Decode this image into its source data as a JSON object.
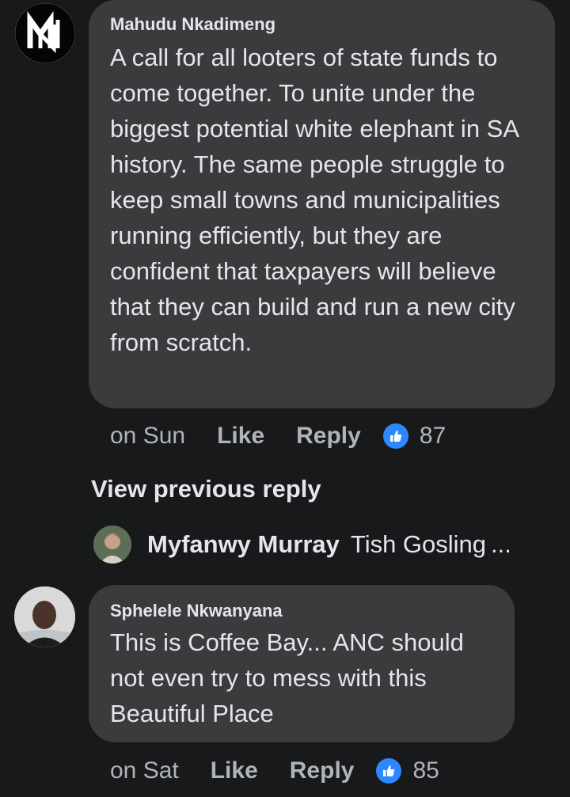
{
  "comments": [
    {
      "author": "Mahudu Nkadimeng",
      "text": "A call for all looters of state funds to come together. To unite under the biggest potential white elephant in SA history. The same people struggle to keep small towns and municipalities running efficiently, but they are confident that taxpayers will believe that they can build and run a new city from scratch.",
      "time": "on Sun",
      "like_label": "Like",
      "reply_label": "Reply",
      "like_count": "87"
    },
    {
      "author": "Sphelele Nkwanyana",
      "text": "This is Coffee Bay... ANC should not even try to mess with this Beautiful Place",
      "time": "on Sat",
      "like_label": "Like",
      "reply_label": "Reply",
      "like_count": "85"
    }
  ],
  "view_previous_reply": "View previous reply",
  "reply_preview": {
    "name": "Myfanwy Murray",
    "snippet": "Tish Gosling",
    "ellipsis": "..."
  },
  "colors": {
    "background": "#18191a",
    "bubble": "#3a3b3c",
    "like_badge": "#2d88ff"
  },
  "icons": {
    "avatar1": "mn-logo-avatar",
    "like": "thumbs-up-icon"
  }
}
